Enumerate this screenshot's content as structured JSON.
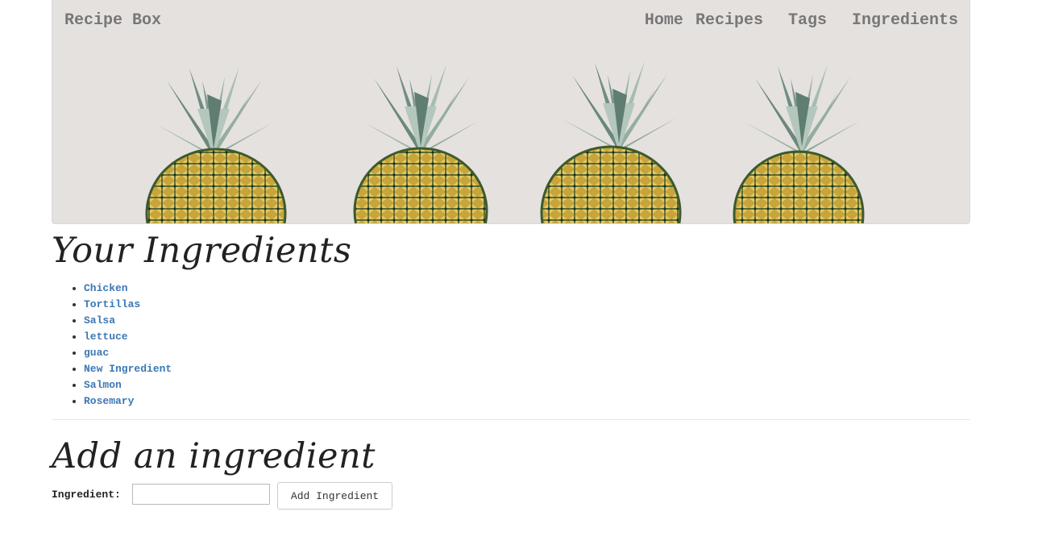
{
  "navbar": {
    "brand": "Recipe Box",
    "links": [
      "Home",
      "Recipes",
      "Tags",
      "Ingredients"
    ]
  },
  "hero": {
    "image": "pineapples-photo"
  },
  "ingredients_section": {
    "title": "Your Ingredients",
    "items": [
      "Chicken",
      "Tortillas",
      "Salsa",
      "lettuce",
      "guac",
      "New Ingredient",
      "Salmon",
      "Rosemary"
    ]
  },
  "add_section": {
    "title": "Add an ingredient",
    "field_label": "Ingredient:",
    "field_value": "",
    "button_label": "Add Ingredient"
  },
  "colors": {
    "link": "#3b78b5",
    "nav_text": "#777777",
    "hero_bg": "#e5e1df",
    "pineapple_leaf": "#8fa89c",
    "pineapple_fruit": "#c9a93a"
  }
}
